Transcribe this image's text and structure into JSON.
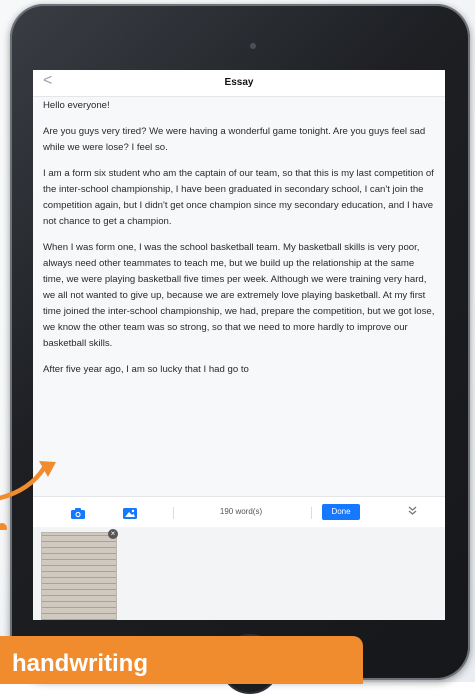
{
  "nav": {
    "back_glyph": "<",
    "title": "Essay"
  },
  "essay": {
    "paragraphs": [
      "Hello everyone!",
      "Are you guys very tired? We were having a wonderful game tonight. Are you guys feel sad while we were lose? I feel so.",
      "I am a form six student who am the captain of our team, so that this is my last competition of the inter-school championship, I have been graduated in secondary school, I can't join the competition again, but I didn't get once champion since my secondary education, and I have not chance to get a champion.",
      "When I was form one, I was the school basketball team. My basketball skills is very poor, always need other teammates to teach me, but we build up the relationship at the same time, we were playing basketball five times per week. Although we were training very hard, we all not wanted to give up, because we are extremely love playing basketball. At my first time joined the inter-school championship, we had, prepare the competition, but we got lose, we know the other team was so strong, so that we need to more hardly to improve our basketball skills.",
      "After five year ago, I am so lucky that I had go to"
    ]
  },
  "toolbar": {
    "word_count": "190 word(s)",
    "done_label": "Done",
    "camera_icon": "camera-icon",
    "image_icon": "image-icon",
    "collapse_icon": "double-chevron-down-icon",
    "accent_color": "#1677ff"
  },
  "attachment": {
    "close_glyph": "×"
  },
  "callout": {
    "text": "handwriting",
    "color": "#f08c2e"
  }
}
